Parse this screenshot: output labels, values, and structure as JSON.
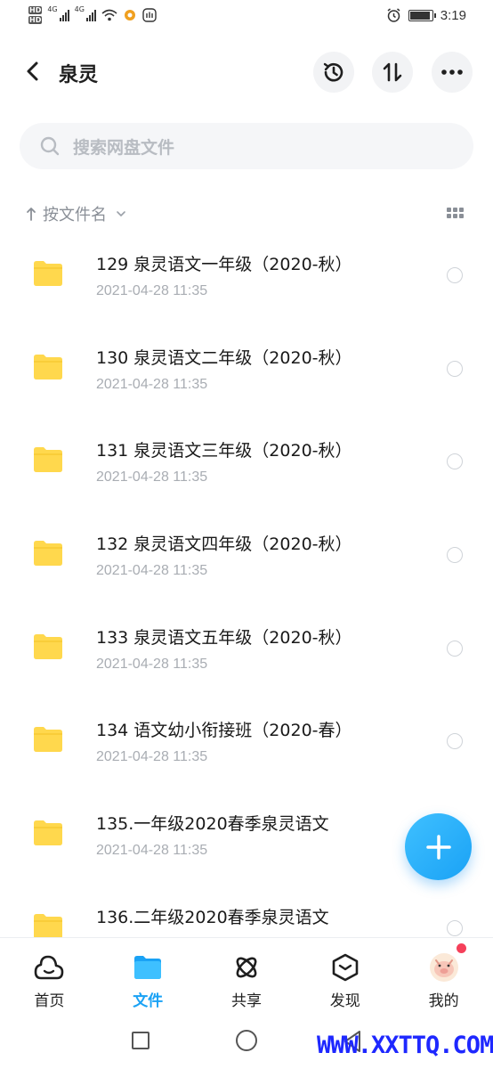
{
  "status_bar": {
    "hd1": "HD",
    "hd2": "HD",
    "net1": "4G",
    "net2": "4G",
    "time": "3:19"
  },
  "header": {
    "title": "泉灵",
    "back_icon": "chevron-left-icon",
    "history_icon": "history-icon",
    "sort_icon": "sort-arrows-icon",
    "more_icon": "more-dots-icon"
  },
  "search": {
    "placeholder": "搜索网盘文件"
  },
  "sort": {
    "label": "按文件名"
  },
  "files": [
    {
      "name": "129 泉灵语文一年级（2020-秋）",
      "date": "2021-04-28  11:35"
    },
    {
      "name": "130 泉灵语文二年级（2020-秋）",
      "date": "2021-04-28  11:35"
    },
    {
      "name": "131 泉灵语文三年级（2020-秋）",
      "date": "2021-04-28  11:35"
    },
    {
      "name": "132 泉灵语文四年级（2020-秋）",
      "date": "2021-04-28  11:35"
    },
    {
      "name": "133 泉灵语文五年级（2020-秋）",
      "date": "2021-04-28  11:35"
    },
    {
      "name": "134 语文幼小衔接班（2020-春）",
      "date": "2021-04-28  11:35"
    },
    {
      "name": "135.一年级2020春季泉灵语文",
      "date": "2021-04-28  11:35"
    },
    {
      "name": "136.二年级2020春季泉灵语文",
      "date": ""
    }
  ],
  "bottom_nav": [
    {
      "label": "首页",
      "icon": "cloud-home-icon"
    },
    {
      "label": "文件",
      "icon": "folder-icon"
    },
    {
      "label": "共享",
      "icon": "share-orbit-icon"
    },
    {
      "label": "发现",
      "icon": "discover-icon"
    },
    {
      "label": "我的",
      "icon": "avatar-icon"
    }
  ],
  "colors": {
    "accent": "#1aa2f5",
    "folder": "#ffd84d",
    "badge": "#f5405a"
  },
  "watermark": "WWW.XXTTQ.COM"
}
